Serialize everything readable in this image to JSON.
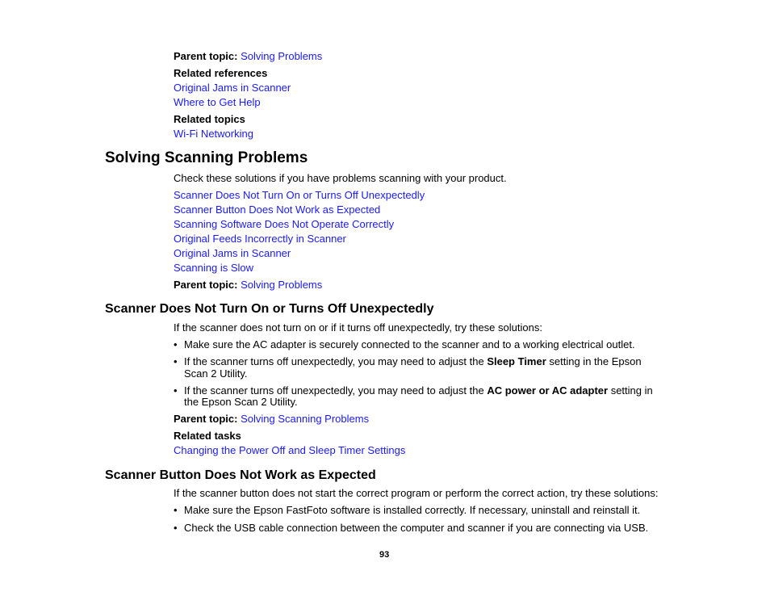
{
  "top_block": {
    "parent_topic_label": "Parent topic:",
    "parent_topic_link": "Solving Problems",
    "related_references_label": "Related references",
    "related_references": [
      "Original Jams in Scanner",
      "Where to Get Help"
    ],
    "related_topics_label": "Related topics",
    "related_topics": [
      "Wi-Fi Networking"
    ]
  },
  "section1": {
    "title": "Solving Scanning Problems",
    "intro": "Check these solutions if you have problems scanning with your product.",
    "links": [
      "Scanner Does Not Turn On or Turns Off Unexpectedly",
      "Scanner Button Does Not Work as Expected",
      "Scanning Software Does Not Operate Correctly",
      "Original Feeds Incorrectly in Scanner",
      "Original Jams in Scanner",
      "Scanning is Slow"
    ],
    "parent_topic_label": "Parent topic:",
    "parent_topic_link": "Solving Problems"
  },
  "section2": {
    "title": "Scanner Does Not Turn On or Turns Off Unexpectedly",
    "intro": "If the scanner does not turn on or if it turns off unexpectedly, try these solutions:",
    "bullet1": "Make sure the AC adapter is securely connected to the scanner and to a working electrical outlet.",
    "bullet2_pre": "If the scanner turns off unexpectedly, you may need to adjust the ",
    "bullet2_bold": "Sleep Timer",
    "bullet2_post": " setting in the Epson",
    "bullet2_line2": "Scan 2 Utility.",
    "bullet3_pre": "If the scanner turns off unexpectedly, you may need to adjust the ",
    "bullet3_bold": "AC power or AC adapter",
    "bullet3_post": " setting in",
    "bullet3_line2": "the Epson Scan 2 Utility.",
    "parent_topic_label": "Parent topic:",
    "parent_topic_link": "Solving Scanning Problems",
    "related_tasks_label": "Related tasks",
    "related_tasks": [
      "Changing the Power Off and Sleep Timer Settings"
    ]
  },
  "section3": {
    "title": "Scanner Button Does Not Work as Expected",
    "intro": "If the scanner button does not start the correct program or perform the correct action, try these solutions:",
    "bullet1": "Make sure the Epson FastFoto software is installed correctly. If necessary, uninstall and reinstall it.",
    "bullet2": "Check the USB cable connection between the computer and scanner if you are connecting via USB."
  },
  "bullet_glyph": "•",
  "page_number": "93",
  "colors": {
    "link": "#1a1aff",
    "text": "#000000"
  }
}
